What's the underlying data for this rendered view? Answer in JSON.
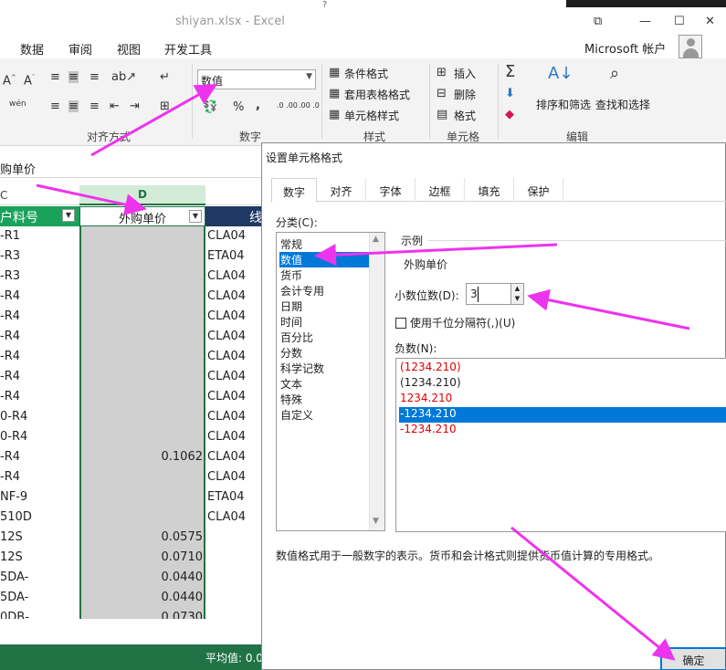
{
  "window": {
    "title": "shiyan.xlsx - Excel",
    "help": "?",
    "account": "Microsoft 帐户",
    "controls": {
      "restore": "⧉",
      "minimize": "—",
      "maximize": "☐",
      "close": "✕"
    }
  },
  "menu_tabs": [
    "数据",
    "审阅",
    "视图",
    "开发工具"
  ],
  "ribbon": {
    "number_format_value": "数值",
    "groups": {
      "alignment": "对齐方式",
      "number": "数字",
      "styles": "样式",
      "cells": "单元格",
      "editing": "编辑"
    },
    "styles_items": [
      "条件格式",
      "套用表格格式",
      "单元格样式"
    ],
    "cells_items": [
      "插入",
      "删除",
      "格式"
    ],
    "editing_items": [
      "排序和筛选",
      "查找和选择"
    ],
    "wen_label": "wén",
    "percent": "%",
    "comma": ",",
    "dec_increase": ".0 .00",
    "dec_decrease": ".00 .0"
  },
  "formula_bar": {
    "value": "购单价"
  },
  "sheet": {
    "col_c": "C",
    "col_d": "D",
    "header_c": "户料号",
    "header_d": "外购单价",
    "header_e": "线",
    "rows": [
      {
        "c": "-R1",
        "d": "",
        "e": "CLA04"
      },
      {
        "c": "-R3",
        "d": "",
        "e": "ETA04"
      },
      {
        "c": "-R3",
        "d": "",
        "e": "CLA04"
      },
      {
        "c": "-R4",
        "d": "",
        "e": "CLA04"
      },
      {
        "c": "-R4",
        "d": "",
        "e": "CLA04"
      },
      {
        "c": "-R4",
        "d": "",
        "e": "CLA04"
      },
      {
        "c": "-R4",
        "d": "",
        "e": "CLA04"
      },
      {
        "c": "-R4",
        "d": "",
        "e": "CLA04"
      },
      {
        "c": "-R4",
        "d": "",
        "e": "CLA04"
      },
      {
        "c": "0-R4",
        "d": "",
        "e": "CLA04"
      },
      {
        "c": "0-R4",
        "d": "",
        "e": "CLA04"
      },
      {
        "c": "-R4",
        "d": "0.1062",
        "e": "CLA04"
      },
      {
        "c": "-R4",
        "d": "",
        "e": "CLA04"
      },
      {
        "c": "NF-9",
        "d": "",
        "e": "ETA04"
      },
      {
        "c": "510D",
        "d": "",
        "e": "CLA04"
      },
      {
        "c": "12S",
        "d": "0.0575",
        "e": ""
      },
      {
        "c": "12S",
        "d": "0.0710",
        "e": ""
      },
      {
        "c": "5DA-",
        "d": "0.0440",
        "e": ""
      },
      {
        "c": "5DA-",
        "d": "0.0440",
        "e": ""
      },
      {
        "c": "0DB-",
        "d": "0.0730",
        "e": ""
      }
    ],
    "status": "平均值: 0.0"
  },
  "dialog": {
    "title": "设置单元格格式",
    "tabs": [
      "数字",
      "对齐",
      "字体",
      "边框",
      "填充",
      "保护"
    ],
    "category_label": "分类(C):",
    "categories": [
      "常规",
      "数值",
      "货币",
      "会计专用",
      "日期",
      "时间",
      "百分比",
      "分数",
      "科学记数",
      "文本",
      "特殊",
      "自定义"
    ],
    "sample_label": "示例",
    "sample_value": "外购单价",
    "decimal_label": "小数位数(D):",
    "decimal_value": "3",
    "thousand_label": "使用千位分隔符(,)(U)",
    "negative_label": "负数(N):",
    "negative_options": [
      "(1234.210)",
      "(1234.210)",
      "1234.210",
      "-1234.210",
      "-1234.210"
    ],
    "description": "数值格式用于一般数字的表示。货币和会计格式则提供货币值计算的专用格式。",
    "ok": "确定"
  },
  "colors": {
    "excel_green": "#217346",
    "accent_blue": "#0078d7",
    "annotation": "#ee33ee",
    "negative_red": "#e00000"
  }
}
